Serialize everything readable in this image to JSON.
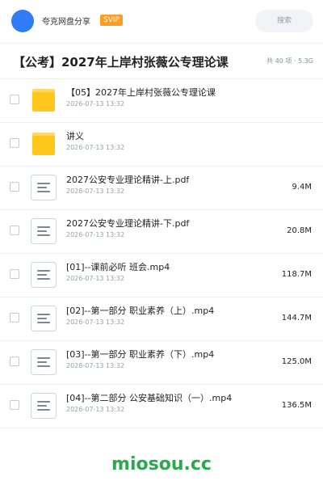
{
  "header": {
    "share_name": "夸克网盘分享",
    "badge": "SVIP",
    "search_label": "搜索"
  },
  "title": {
    "text": "【公考】2027年上岸村张薇公专理论课",
    "summary": "共 40 项 · 5.3G"
  },
  "files": [
    {
      "type": "folder",
      "name": "【05】2027年上岸村张薇公专理论课",
      "date": "2026-07-13 13:32",
      "size": ""
    },
    {
      "type": "folder",
      "name": "讲义",
      "date": "2026-07-13 13:32",
      "size": ""
    },
    {
      "type": "file",
      "name": "2027公安专业理论精讲-上.pdf",
      "date": "2026-07-13 13:32",
      "size": "9.4M"
    },
    {
      "type": "file",
      "name": "2027公安专业理论精讲-下.pdf",
      "date": "2026-07-13 13:32",
      "size": "20.8M"
    },
    {
      "type": "file",
      "name": "[01]--课前必听 班会.mp4",
      "date": "2026-07-13 13:32",
      "size": "118.7M"
    },
    {
      "type": "file",
      "name": "[02]--第一部分 职业素养（上）.mp4",
      "date": "2026-07-13 13:32",
      "size": "144.7M"
    },
    {
      "type": "file",
      "name": "[03]--第一部分 职业素养（下）.mp4",
      "date": "2026-07-13 13:32",
      "size": "125.0M"
    },
    {
      "type": "file",
      "name": "[04]--第二部分 公安基础知识（一）.mp4",
      "date": "2026-07-13 13:32",
      "size": "136.5M"
    }
  ],
  "watermark": "miosou.cc",
  "colors": {
    "accent": "#2f7cf6",
    "svip": "#ff9c24",
    "folder": "#ffc61c",
    "watermark": "#2ca94f"
  }
}
